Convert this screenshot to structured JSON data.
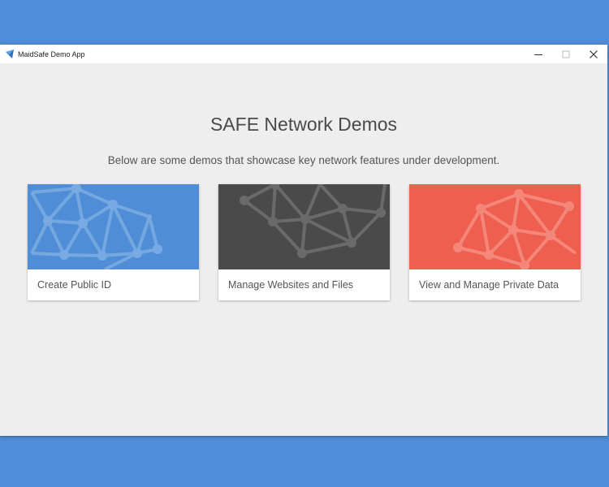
{
  "window": {
    "title": "MaidSafe Demo App",
    "controls": [
      "minimize",
      "maximize",
      "close"
    ]
  },
  "main": {
    "title": "SAFE Network Demos",
    "subtitle": "Below are some demos that showcase key network features under development."
  },
  "cards": [
    {
      "label": "Create Public ID",
      "color": "#4f8ed6",
      "pattern": "network-mesh-icon"
    },
    {
      "label": "Manage Websites and Files",
      "color": "#4a4a4a",
      "pattern": "network-mesh-icon"
    },
    {
      "label": "View and Manage Private Data",
      "color": "#ef5f4f",
      "pattern": "network-mesh-icon"
    }
  ],
  "colors": {
    "desktop": "#4f8dd8",
    "window_bg": "#eeeeee",
    "accent_blue": "#4f8ed6",
    "accent_dark": "#4a4a4a",
    "accent_red": "#ef5f4f"
  }
}
